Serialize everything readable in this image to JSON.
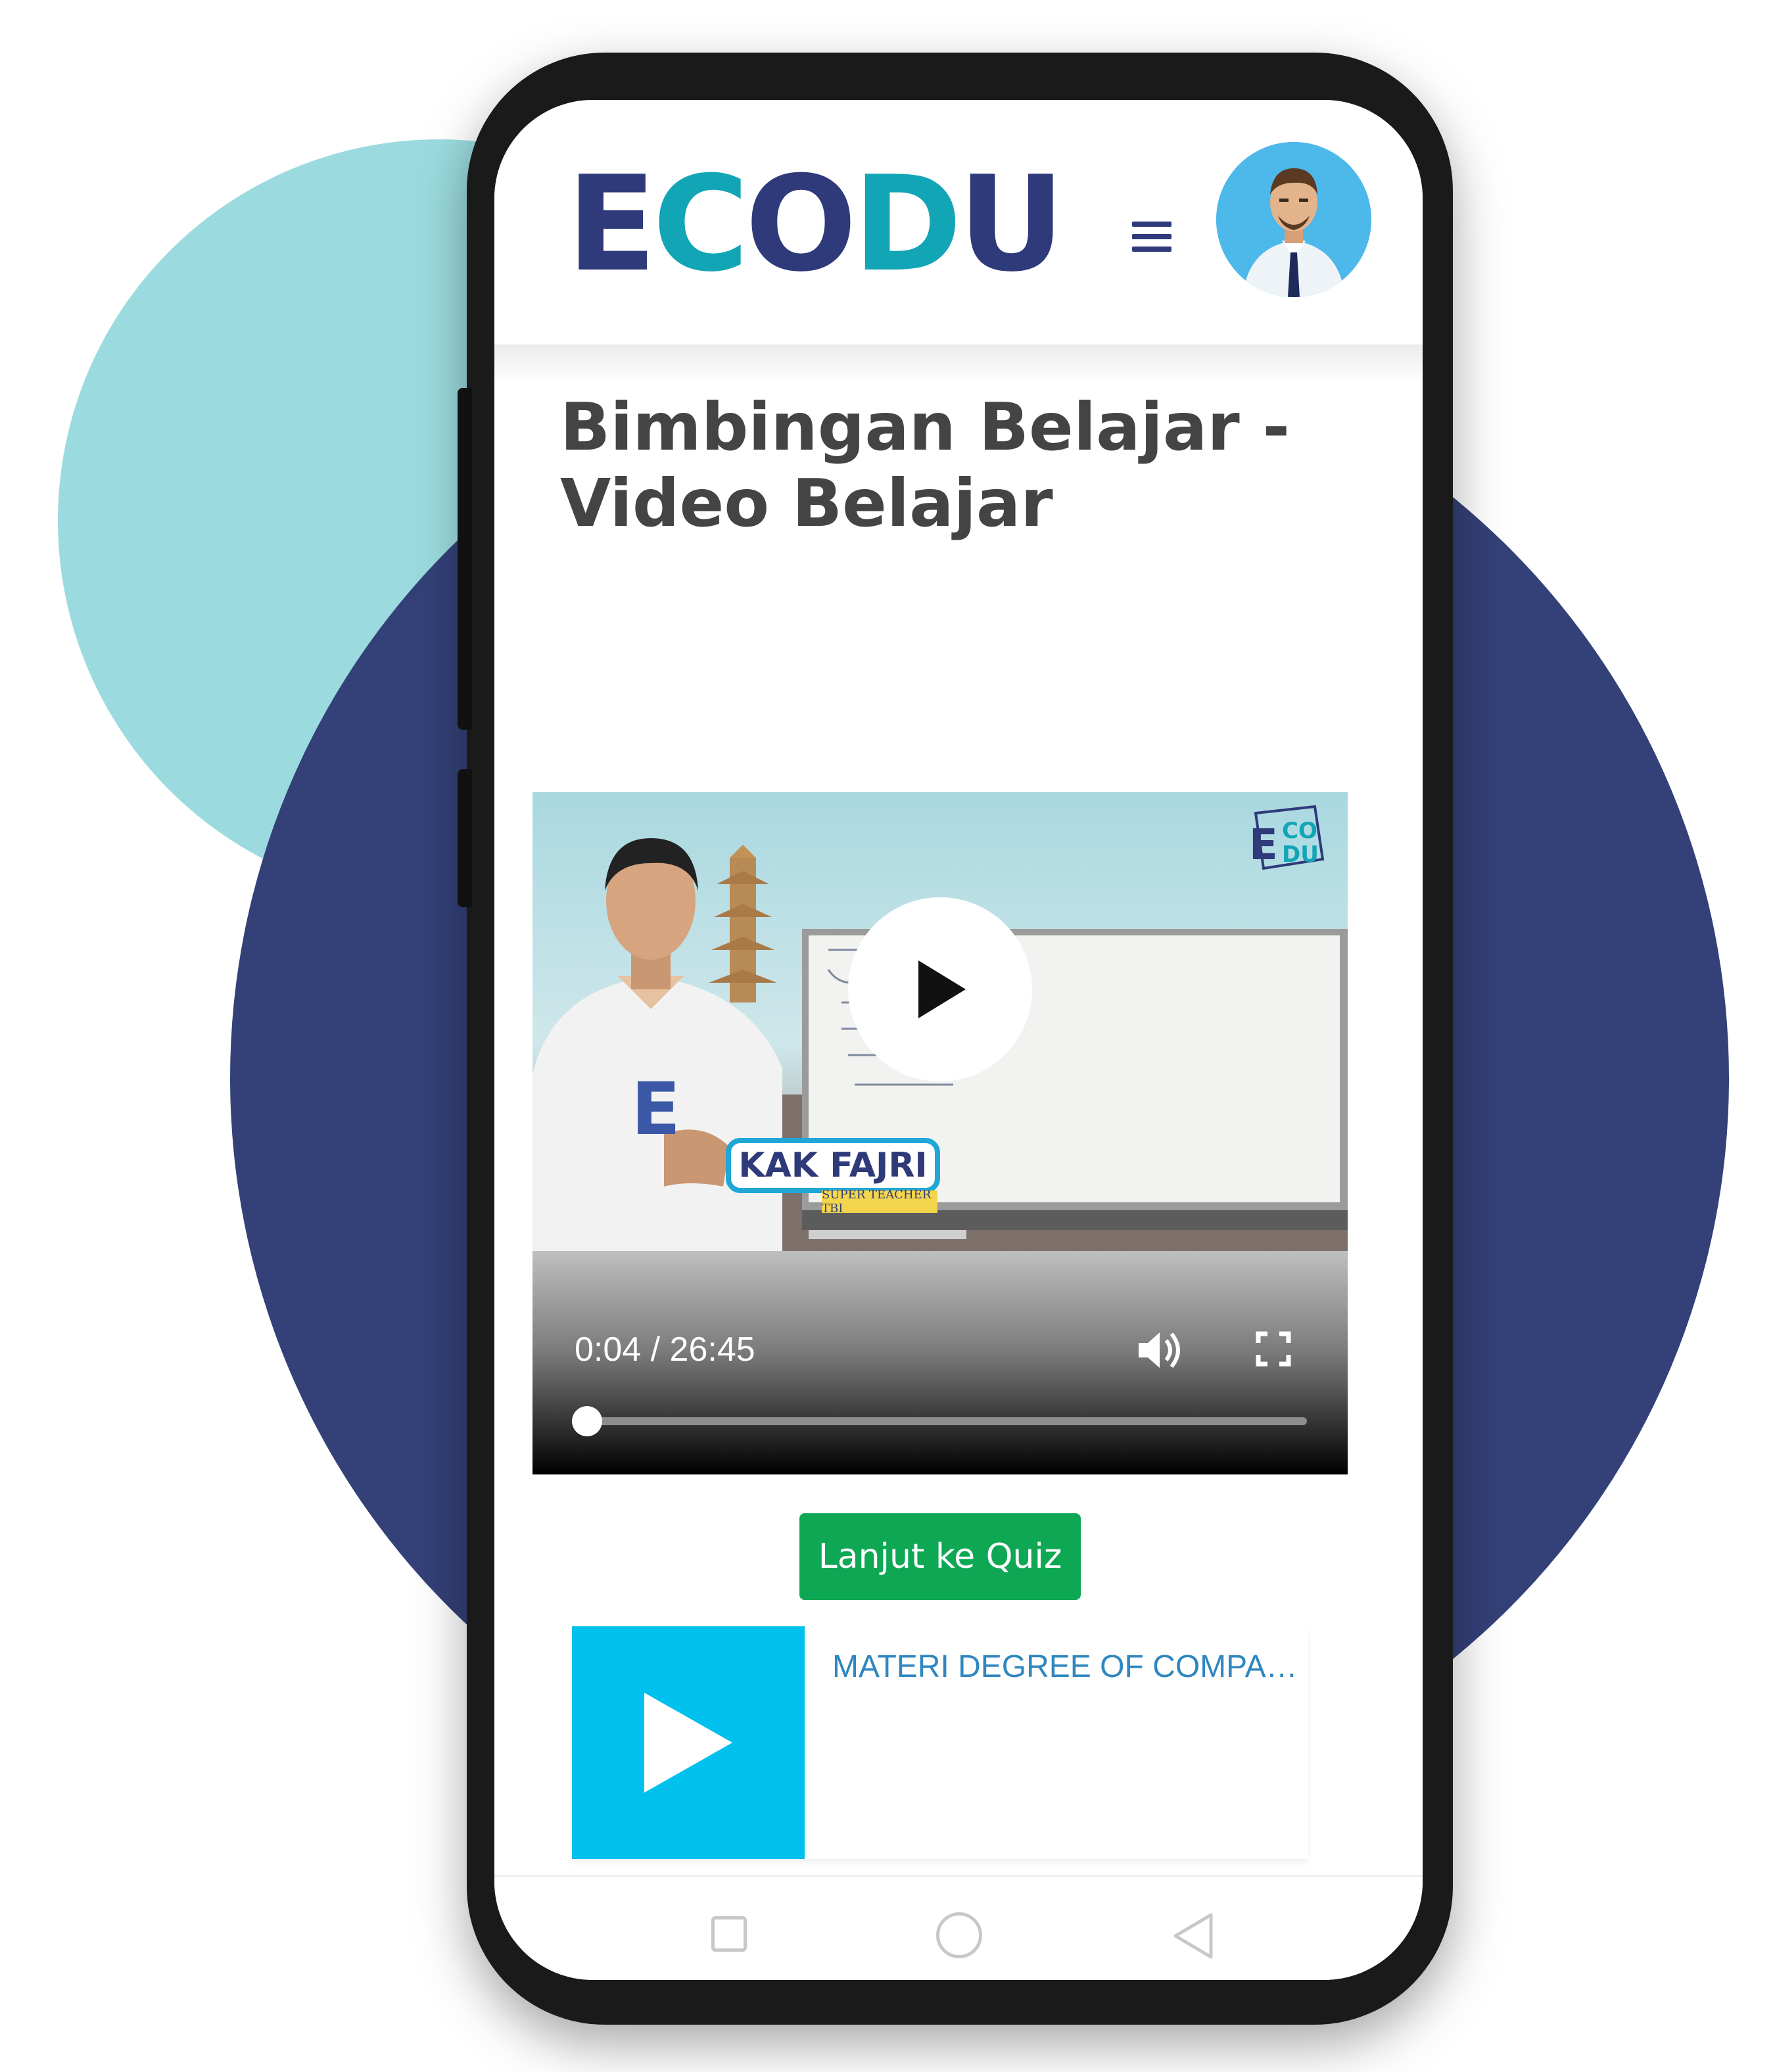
{
  "brand": {
    "logo": [
      "E",
      "C",
      "O",
      "D",
      "U"
    ],
    "colors": {
      "navy": "#2f3a7a",
      "teal": "#12a5b6",
      "green": "#0ea855",
      "cyan": "#00c0ee"
    }
  },
  "header": {
    "menu_icon": "hamburger-icon",
    "avatar_icon": "user-avatar"
  },
  "page": {
    "title_line1": "Bimbingan Belajar -",
    "title_line2": "Video Belajar"
  },
  "video": {
    "current_time": "0:04 / 26:45",
    "progress": 0.0025,
    "thumbnail": {
      "brand_mark": [
        "E",
        "CO",
        "DU"
      ],
      "presenter_name": "KAK FAJRI",
      "presenter_tag": "SUPER TEACHER TBI"
    },
    "icons": {
      "play": "play-icon",
      "volume": "volume-icon",
      "fullscreen": "fullscreen-icon"
    }
  },
  "actions": {
    "quiz_label": "Lanjut ke Quiz"
  },
  "playlist": [
    {
      "title": "MATERI DEGREE OF COMPA…",
      "icon": "play-icon"
    }
  ],
  "navbar": {
    "icons": [
      "recent-apps-icon",
      "home-icon",
      "back-icon"
    ]
  }
}
